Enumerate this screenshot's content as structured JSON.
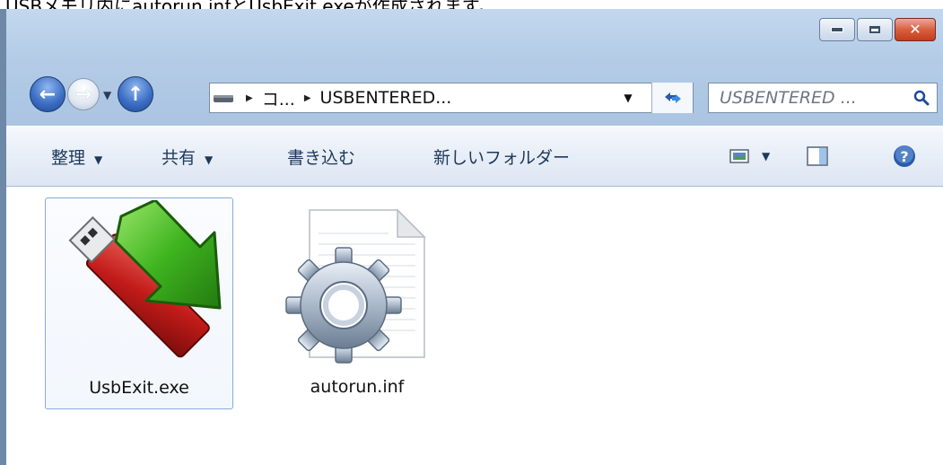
{
  "caption": "USBメモリ内にautorun.infとUsbExit.exeが作成されます。",
  "window": {
    "buttons": {
      "minimize": "minimize-icon",
      "maximize": "maximize-icon",
      "close": "close-icon"
    }
  },
  "address": {
    "crumbs": [
      "コ...",
      "USBENTERED..."
    ],
    "search_placeholder": "USBENTERED ..."
  },
  "toolbar": {
    "organize": "整理",
    "share": "共有",
    "burn": "書き込む",
    "new_folder": "新しいフォルダー"
  },
  "files": [
    {
      "name": "UsbExit.exe",
      "icon": "usb-exit-icon",
      "selected": true
    },
    {
      "name": "autorun.inf",
      "icon": "settings-file-icon",
      "selected": false
    }
  ],
  "colors": {
    "accent": "#3d6fc4",
    "toolbar_text": "#1e395b",
    "selection_border": "#84acdd",
    "close_red": "#c23d1f"
  }
}
